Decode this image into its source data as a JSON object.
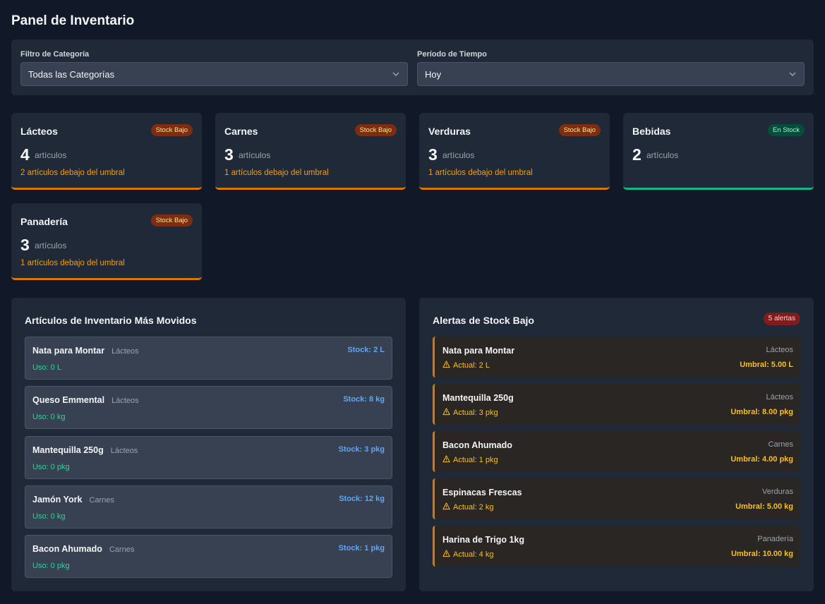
{
  "page": {
    "title": "Panel de Inventario"
  },
  "filters": {
    "category": {
      "label": "Filtro de Categoría",
      "value": "Todas las Categorías"
    },
    "period": {
      "label": "Período de Tiempo",
      "value": "Hoy"
    }
  },
  "categories": [
    {
      "name": "Lácteos",
      "badge": "Stock Bajo",
      "count": "4",
      "unit": "artículos",
      "below": "2 artículos debajo del umbral"
    },
    {
      "name": "Carnes",
      "badge": "Stock Bajo",
      "count": "3",
      "unit": "artículos",
      "below": "1 artículos debajo del umbral"
    },
    {
      "name": "Verduras",
      "badge": "Stock Bajo",
      "count": "3",
      "unit": "artículos",
      "below": "1 artículos debajo del umbral"
    },
    {
      "name": "Bebidas",
      "badge": "En Stock",
      "count": "2",
      "unit": "artículos",
      "below": ""
    },
    {
      "name": "Panadería",
      "badge": "Stock Bajo",
      "count": "3",
      "unit": "artículos",
      "below": "1 artículos debajo del umbral"
    }
  ],
  "top_moved": {
    "title": "Artículos de Inventario Más Movidos",
    "items": [
      {
        "name": "Nata para Montar",
        "category": "Lácteos",
        "stock": "Stock: 2 L",
        "usage": "Uso: 0 L"
      },
      {
        "name": "Queso Emmental",
        "category": "Lácteos",
        "stock": "Stock: 8 kg",
        "usage": "Uso: 0 kg"
      },
      {
        "name": "Mantequilla 250g",
        "category": "Lácteos",
        "stock": "Stock: 3 pkg",
        "usage": "Uso: 0 pkg"
      },
      {
        "name": "Jamón York",
        "category": "Carnes",
        "stock": "Stock: 12 kg",
        "usage": "Uso: 0 kg"
      },
      {
        "name": "Bacon Ahumado",
        "category": "Carnes",
        "stock": "Stock: 1 pkg",
        "usage": "Uso: 0 pkg"
      }
    ]
  },
  "alerts": {
    "title": "Alertas de Stock Bajo",
    "badge": "5 alertas",
    "items": [
      {
        "name": "Nata para Montar",
        "category": "Lácteos",
        "actual": "Actual: 2 L",
        "threshold": "Umbral: 5.00 L"
      },
      {
        "name": "Mantequilla 250g",
        "category": "Lácteos",
        "actual": "Actual: 3 pkg",
        "threshold": "Umbral: 8.00 pkg"
      },
      {
        "name": "Bacon Ahumado",
        "category": "Carnes",
        "actual": "Actual: 1 pkg",
        "threshold": "Umbral: 4.00 pkg"
      },
      {
        "name": "Espinacas Frescas",
        "category": "Verduras",
        "actual": "Actual: 2 kg",
        "threshold": "Umbral: 5.00 kg"
      },
      {
        "name": "Harina de Trigo 1kg",
        "category": "Panadería",
        "actual": "Actual: 4 kg",
        "threshold": "Umbral: 10.00 kg"
      }
    ]
  },
  "colors": {
    "low_stock": "#d97706",
    "in_stock": "#10b981",
    "stock_text": "#60a5fa",
    "usage_text": "#34d399",
    "warning": "#fbbf24"
  }
}
